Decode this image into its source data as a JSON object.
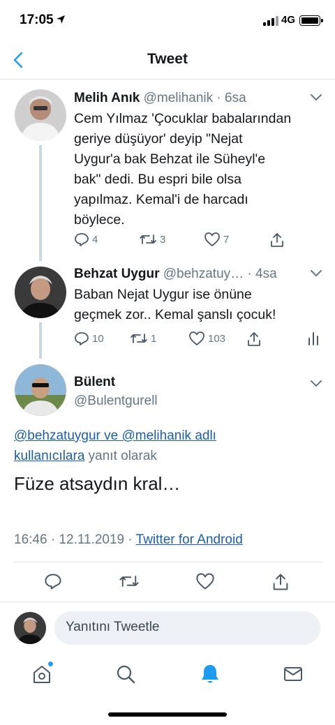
{
  "status_bar": {
    "time": "17:05",
    "network": "4G"
  },
  "nav": {
    "title": "Tweet"
  },
  "thread": [
    {
      "name": "Melih Anık",
      "handle": "@melihanik",
      "time": "· 6sa",
      "text": "Cem Yılmaz 'Çocuklar babalarından\ngeriye düşüyor' deyip \"Nejat\nUygur'a bak Behzat ile Süheyl'e\nbak\" dedi. Bu espri bile olsa\nyapılmaz. Kemal'i de harcadı\nböylece.",
      "replies": "4",
      "retweets": "3",
      "likes": "7"
    },
    {
      "name": "Behzat Uygur",
      "handle": "@behzatuy…",
      "time": "· 4sa",
      "text": "Baban Nejat Uygur ise önüne\ngeçmek zor.. Kemal şanslı çocuk!",
      "replies": "10",
      "retweets": "1",
      "likes": "103"
    }
  ],
  "main_tweet": {
    "name": "Bülent",
    "handle": "@Bulentgurell",
    "reply_mention_1": "@behzatuygur",
    "reply_and": " ve ",
    "reply_mention_2": "@melihanik",
    "reply_users_link_1": " adlı",
    "reply_users_link_2": "kullanıcılara",
    "reply_suffix": " yanıt olarak",
    "text": "Füze atsaydın kral…",
    "timestamp": "16:46 · 12.11.2019 · ",
    "source": "Twitter for Android"
  },
  "composer": {
    "placeholder": "Yanıtını Tweetle"
  },
  "colors": {
    "link": "#1b5fa8",
    "accent": "#1da1f2",
    "muted": "#657786",
    "text": "#14171a"
  },
  "icons": {
    "tabs": [
      "home-icon",
      "search-icon",
      "notifications-icon",
      "messages-icon"
    ],
    "actions": [
      "reply-icon",
      "retweet-icon",
      "like-icon",
      "share-icon",
      "analytics-icon"
    ]
  }
}
